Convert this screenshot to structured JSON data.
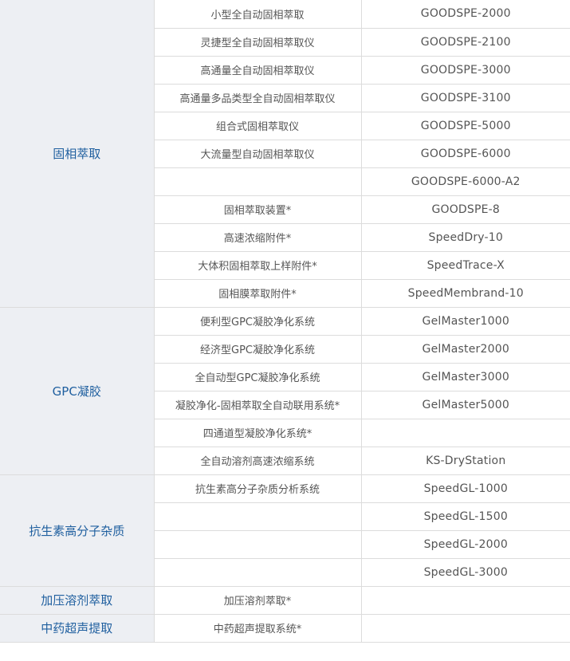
{
  "categories": [
    {
      "name": "固相萃取",
      "rows": [
        {
          "product": "小型全自动固相萃取",
          "model": "GOODSPE-2000"
        },
        {
          "product": "灵捷型全自动固相萃取仪",
          "model": "GOODSPE-2100"
        },
        {
          "product": "高通量全自动固相萃取仪",
          "model": "GOODSPE-3000"
        },
        {
          "product": "高通量多品类型全自动固相萃取仪",
          "model": "GOODSPE-3100"
        },
        {
          "product": "组合式固相萃取仪",
          "model": "GOODSPE-5000"
        },
        {
          "product": "大流量型自动固相萃取仪",
          "model": "GOODSPE-6000"
        },
        {
          "product": "",
          "model": "GOODSPE-6000-A2"
        },
        {
          "product": "固相萃取装置*",
          "model": "GOODSPE-8"
        },
        {
          "product": "高速浓缩附件*",
          "model": "SpeedDry-10"
        },
        {
          "product": "大体积固相萃取上样附件*",
          "model": "SpeedTrace-X"
        },
        {
          "product": "固相膜萃取附件*",
          "model": "SpeedMembrand-10"
        }
      ]
    },
    {
      "name": "GPC凝胶",
      "rows": [
        {
          "product": "便利型GPC凝胶净化系统",
          "model": "GelMaster1000"
        },
        {
          "product": "经济型GPC凝胶净化系统",
          "model": "GelMaster2000"
        },
        {
          "product": "全自动型GPC凝胶净化系统",
          "model": "GelMaster3000"
        },
        {
          "product": "凝胶净化-固相萃取全自动联用系统*",
          "model": "GelMaster5000"
        },
        {
          "product": "四通道型凝胶净化系统*",
          "model": ""
        },
        {
          "product": "全自动溶剂高速浓缩系统",
          "model": "KS-DryStation"
        }
      ]
    },
    {
      "name": "抗生素高分子杂质",
      "rows": [
        {
          "product": "抗生素高分子杂质分析系统",
          "model": "SpeedGL-1000"
        },
        {
          "product": "",
          "model": "SpeedGL-1500"
        },
        {
          "product": "",
          "model": "SpeedGL-2000"
        },
        {
          "product": "",
          "model": "SpeedGL-3000"
        }
      ]
    },
    {
      "name": "加压溶剂萃取",
      "rows": [
        {
          "product": "加压溶剂萃取*",
          "model": ""
        }
      ]
    },
    {
      "name": "中药超声提取",
      "rows": [
        {
          "product": "中药超声提取系统*",
          "model": ""
        }
      ]
    }
  ],
  "colors": {
    "category_bg": "#edeff3",
    "category_text": "#1f5f9f",
    "body_text": "#555555",
    "border": "#dcdcdc"
  }
}
